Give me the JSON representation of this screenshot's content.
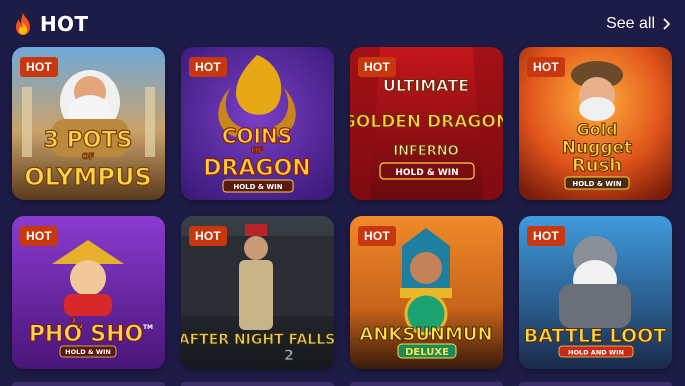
{
  "header": {
    "icon": "fire-icon",
    "title": "HOT",
    "see_all_label": "See all",
    "see_all_icon": "chevron-right-icon"
  },
  "colors": {
    "background": "#1d1c46",
    "badge": "#c9370f",
    "text": "#ffffff"
  },
  "games": [
    {
      "badge": "HOT",
      "title_line1": "3 POTS",
      "title_line2": "OF",
      "title_line3": "OLYMPUS",
      "tag": ""
    },
    {
      "badge": "HOT",
      "title_line1": "COINS",
      "title_line2": "OF",
      "title_line3": "DRAGON",
      "tag": "HOLD & WIN"
    },
    {
      "badge": "HOT",
      "title_line1": "ULTIMATE",
      "title_line2": "GOLDEN DRAGON",
      "title_line3": "INFERNO",
      "tag": "HOLD & WIN"
    },
    {
      "badge": "HOT",
      "title_line1": "Gold",
      "title_line2": "Nugget",
      "title_line3": "Rush",
      "tag": "HOLD & WIN"
    },
    {
      "badge": "HOT",
      "title_line1": "PHỞ SHO",
      "title_line2": "TM",
      "title_line3": "",
      "tag": "HOLD & WIN"
    },
    {
      "badge": "HOT",
      "title_line1": "AFTER NIGHT FALLS",
      "title_line2": "2",
      "title_line3": "",
      "tag": ""
    },
    {
      "badge": "HOT",
      "title_line1": "ANKSUNMUN",
      "title_line2": "DELUXE",
      "title_line3": "",
      "tag": ""
    },
    {
      "badge": "HOT",
      "title_line1": "BATTLE LOOT",
      "title_line2": "",
      "title_line3": "",
      "tag": "HOLD AND WIN"
    }
  ]
}
